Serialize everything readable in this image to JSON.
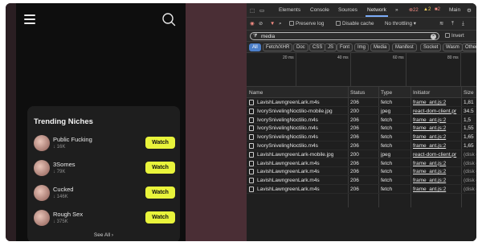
{
  "mobile": {
    "section_title": "Trending Niches",
    "niches": [
      {
        "name": "Public Fucking",
        "count": "16K",
        "button": "Watch"
      },
      {
        "name": "3Somes",
        "count": "79K",
        "button": "Watch"
      },
      {
        "name": "Cucked",
        "count": "146K",
        "button": "Watch"
      },
      {
        "name": "Rough Sex",
        "count": "375K",
        "button": "Watch"
      }
    ],
    "see_all": "See All",
    "colors": {
      "watch_button": "#e9f43b",
      "card_bg": "#1e1e1e"
    }
  },
  "devtools": {
    "tabs": [
      "Elements",
      "Console",
      "Sources",
      "Network",
      "Main"
    ],
    "active_tab": "Network",
    "errors": "22",
    "warnings": "2",
    "issues": "2",
    "toolbar": {
      "preserve_log": "Preserve log",
      "disable_cache": "Disable cache",
      "throttling": "No throttling"
    },
    "filter": {
      "value": "media",
      "invert": "Invert"
    },
    "type_filters": [
      "All",
      "Fetch/XHR",
      "Doc",
      "CSS",
      "JS",
      "Font",
      "Img",
      "Media",
      "Manifest",
      "Socket",
      "Wasm",
      "Other"
    ],
    "timeline_labels": [
      "20 ms",
      "40 ms",
      "60 ms",
      "80 ms"
    ],
    "columns": {
      "name": "Name",
      "status": "Status",
      "type": "Type",
      "initiator": "Initiator",
      "size": "Size"
    },
    "rows": [
      {
        "name": "LavishLawngreenLark.m4s",
        "status": "206",
        "type": "fetch",
        "initiator": "frame_ant.js:2",
        "size": "1,81"
      },
      {
        "name": "IvorySnivelingNoctilio-mobile.jpg",
        "status": "200",
        "type": "jpeg",
        "initiator": "react-dom-client.pr",
        "size": "34.5"
      },
      {
        "name": "IvorySnivelingNoctilio.m4s",
        "status": "206",
        "type": "fetch",
        "initiator": "frame_ant.js:2",
        "size": "1,5"
      },
      {
        "name": "IvorySnivelingNoctilio.m4s",
        "status": "206",
        "type": "fetch",
        "initiator": "frame_ant.js:2",
        "size": "1,55"
      },
      {
        "name": "IvorySnivelingNoctilio.m4s",
        "status": "206",
        "type": "fetch",
        "initiator": "frame_ant.js:2",
        "size": "1,65"
      },
      {
        "name": "IvorySnivelingNoctilio.m4s",
        "status": "206",
        "type": "fetch",
        "initiator": "frame_ant.js:2",
        "size": "1,65"
      },
      {
        "name": "LavishLawngreenLark-mobile.jpg",
        "status": "200",
        "type": "jpeg",
        "initiator": "react-dom-client.pr",
        "size": "(disk c"
      },
      {
        "name": "LavishLawngreenLark.m4s",
        "status": "206",
        "type": "fetch",
        "initiator": "frame_ant.js:2",
        "size": "(disk c"
      },
      {
        "name": "LavishLawngreenLark.m4s",
        "status": "206",
        "type": "fetch",
        "initiator": "frame_ant.js:2",
        "size": "(disk c"
      },
      {
        "name": "LavishLawngreenLark.m4s",
        "status": "206",
        "type": "fetch",
        "initiator": "frame_ant.js:2",
        "size": "(disk c"
      },
      {
        "name": "LavishLawngreenLark.m4s",
        "status": "206",
        "type": "fetch",
        "initiator": "frame_ant.js:2",
        "size": "(disk c"
      }
    ]
  }
}
